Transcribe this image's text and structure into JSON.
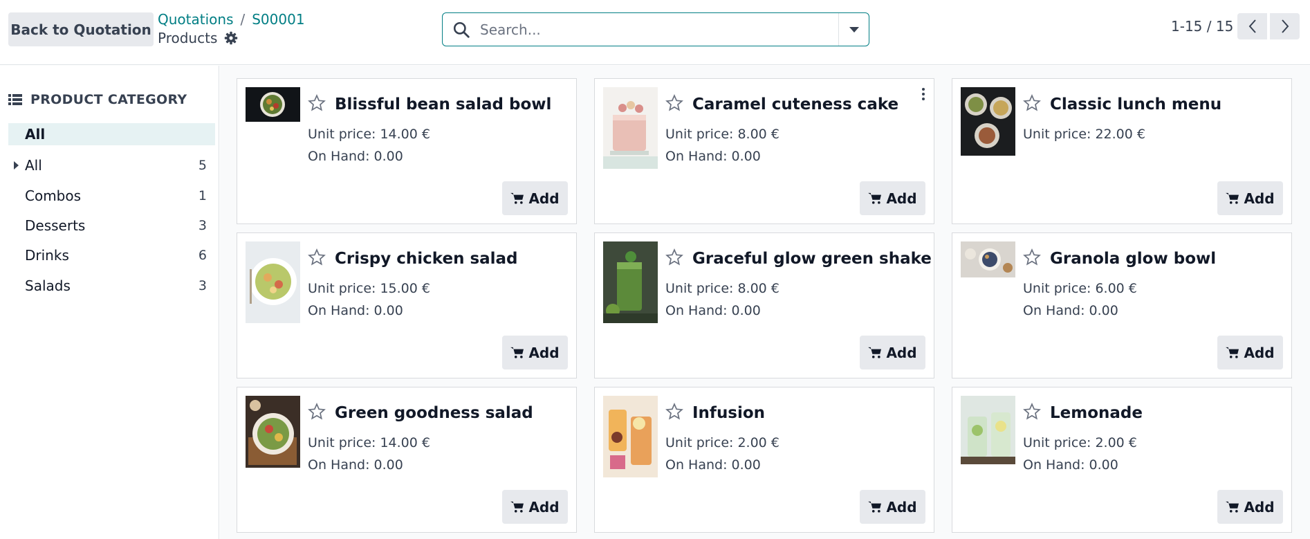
{
  "control_panel": {
    "back_button": "Back to Quotation",
    "breadcrumb": [
      "Quotations",
      "S00001"
    ],
    "breadcrumb_separator": "/",
    "current_page": "Products",
    "search_placeholder": "Search...",
    "pager": "1-15 / 15"
  },
  "sidebar": {
    "header": "PRODUCT CATEGORY",
    "items": [
      {
        "label": "All",
        "count": "",
        "active": true
      },
      {
        "label": "All",
        "count": "5",
        "expandable": true
      },
      {
        "label": "Combos",
        "count": "1"
      },
      {
        "label": "Desserts",
        "count": "3"
      },
      {
        "label": "Drinks",
        "count": "6"
      },
      {
        "label": "Salads",
        "count": "3"
      }
    ]
  },
  "products": [
    {
      "name": "Blissful bean salad bowl",
      "price": "Unit price: 14.00 €",
      "onhand": "On Hand: 0.00",
      "add": "Add"
    },
    {
      "name": "Caramel cuteness cake",
      "price": "Unit price: 8.00 €",
      "onhand": "On Hand: 0.00",
      "add": "Add"
    },
    {
      "name": "Classic lunch menu",
      "price": "Unit price: 22.00 €",
      "onhand": "",
      "add": "Add"
    },
    {
      "name": "Crispy chicken salad",
      "price": "Unit price: 15.00 €",
      "onhand": "On Hand: 0.00",
      "add": "Add"
    },
    {
      "name": "Graceful glow green shake",
      "price": "Unit price: 8.00 €",
      "onhand": "On Hand: 0.00",
      "add": "Add"
    },
    {
      "name": "Granola glow bowl",
      "price": "Unit price: 6.00 €",
      "onhand": "On Hand: 0.00",
      "add": "Add"
    },
    {
      "name": "Green goodness salad",
      "price": "Unit price: 14.00 €",
      "onhand": "On Hand: 0.00",
      "add": "Add"
    },
    {
      "name": "Infusion",
      "price": "Unit price: 2.00 €",
      "onhand": "On Hand: 0.00",
      "add": "Add"
    },
    {
      "name": "Lemonade",
      "price": "Unit price: 2.00 €",
      "onhand": "On Hand: 0.00",
      "add": "Add"
    }
  ],
  "colors": {
    "accent": "#017e84",
    "button_bg": "#e7e9ed",
    "active_category_bg": "#e6f2f3"
  }
}
